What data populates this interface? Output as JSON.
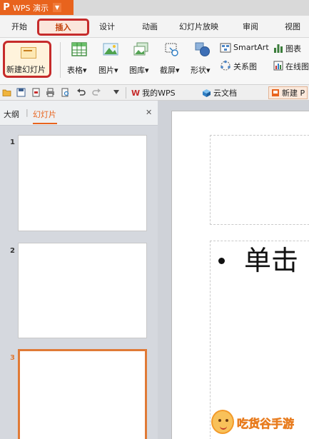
{
  "titlebar": {
    "logo_glyph": "P",
    "app_name": "WPS 演示",
    "menu_caret": "▼"
  },
  "menu_tabs": [
    "开始",
    "插入",
    "设计",
    "动画",
    "幻灯片放映",
    "审阅",
    "视图"
  ],
  "active_menu_tab": "插入",
  "ribbon": {
    "new_slide": "新建幻灯片",
    "table": "表格",
    "picture": "图片",
    "gallery": "图库",
    "screenshot": "截屏",
    "shapes": "形状",
    "smartart": "SmartArt",
    "chart": "图表",
    "relation": "关系图",
    "online": "在线图",
    "dropdown_caret": "▾"
  },
  "quickbar": {
    "doc_tabs": [
      "我的WPS",
      "云文档",
      "新建 P"
    ]
  },
  "sidebar": {
    "tab_outline": "大纲",
    "tab_slides": "幻灯片",
    "close_glyph": "✕",
    "slide_numbers": [
      "1",
      "2",
      "3"
    ],
    "selected_slide": "3"
  },
  "slide": {
    "bullet_text": "单击"
  },
  "watermark": {
    "text": "吃货谷手游"
  },
  "colors": {
    "accent_orange": "#e8631d",
    "highlight_red": "#c62b2b",
    "panel_gray": "#d5d8de"
  }
}
